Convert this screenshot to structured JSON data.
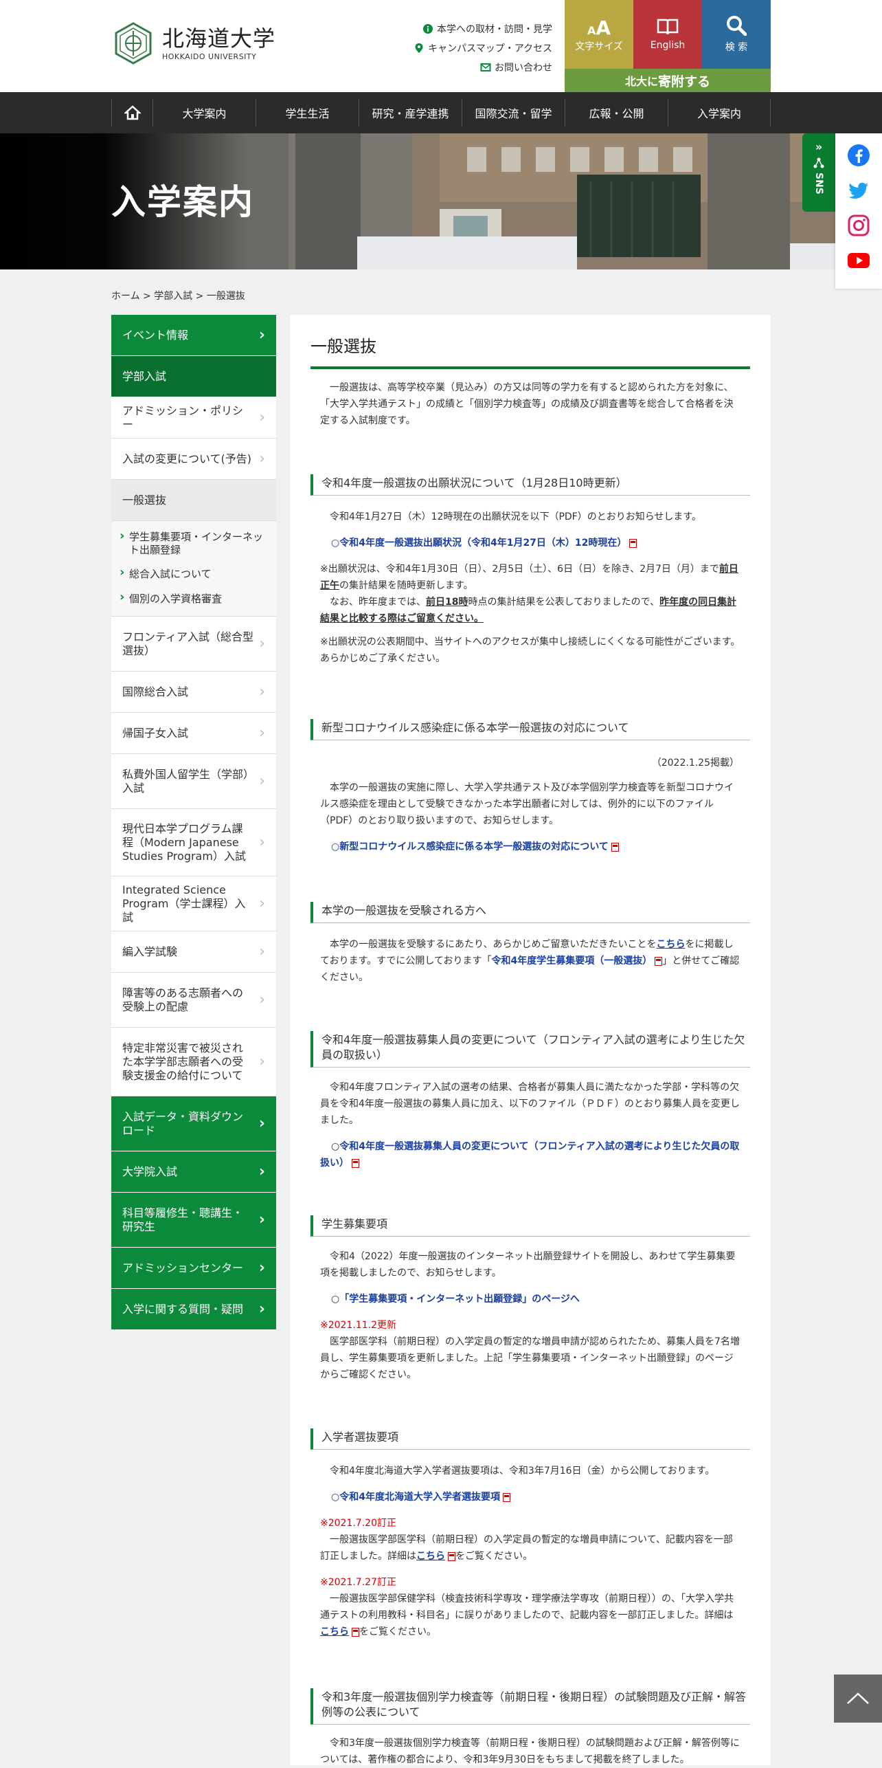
{
  "header": {
    "logo_ja": "北海道大学",
    "logo_en": "HOKKAIDO UNIVERSITY",
    "util_links": [
      "本学への取材・訪問・見学",
      "キャンパスマップ・アクセス",
      "お問い合わせ"
    ],
    "btn_font_size": "文字サイズ",
    "btn_english": "English",
    "btn_search": "検 索",
    "donate_prefix": "北大に",
    "donate_big": "寄附する",
    "colors": {
      "font": "#b9a842",
      "english": "#b8333a",
      "search": "#2b6a9c",
      "donate": "#6c9c3f"
    }
  },
  "gnav": [
    "大学案内",
    "学生生活",
    "研究・産学連携",
    "国際交流・留学",
    "広報・公開",
    "入学案内"
  ],
  "hero": {
    "title": "入学案内",
    "sns_label": "SNS"
  },
  "breadcrumb": "ホーム > 学部入試 > 一般選抜",
  "sidebar": {
    "items": [
      {
        "label": "イベント情報",
        "style": "green"
      },
      {
        "label": "学部入試",
        "style": "dgreen"
      },
      {
        "label": "アドミッション・ポリシー",
        "style": "white"
      },
      {
        "label": "入試の変更について(予告)",
        "style": "white"
      },
      {
        "label": "一般選抜",
        "style": "gray"
      }
    ],
    "sub": [
      "学生募集要項・インターネット出願登録",
      "総合入試について",
      "個別の入学資格審査"
    ],
    "items2": [
      {
        "label": "フロンティア入試（総合型選抜）",
        "style": "white"
      },
      {
        "label": "国際総合入試",
        "style": "white"
      },
      {
        "label": "帰国子女入試",
        "style": "white"
      },
      {
        "label": "私費外国人留学生（学部）入試",
        "style": "white"
      },
      {
        "label": "現代日本学プログラム課程（Modern Japanese Studies Program）入試",
        "style": "white"
      },
      {
        "label": "Integrated Science Program（学士課程）入試",
        "style": "white"
      },
      {
        "label": "編入学試験",
        "style": "white"
      },
      {
        "label": "障害等のある志願者への受験上の配慮",
        "style": "white"
      },
      {
        "label": "特定非常災害で被災された本学学部志願者への受験支援金の給付について",
        "style": "white"
      },
      {
        "label": "入試データ・資料ダウンロード",
        "style": "green"
      },
      {
        "label": "大学院入試",
        "style": "green"
      },
      {
        "label": "科目等履修生・聴講生・研究生",
        "style": "green"
      },
      {
        "label": "アドミッションセンター",
        "style": "green"
      },
      {
        "label": "入学に関する質問・疑問",
        "style": "green"
      }
    ]
  },
  "main": {
    "title": "一般選抜",
    "intro": "一般選抜は、高等学校卒業（見込み）の方又は同等の学力を有すると認められた方を対象に、「大学入学共通テスト」の成績と「個別学力検査等」の成績及び調査書等を総合して合格者を決定する入試制度です。",
    "s1": {
      "heading": "令和4年度一般選抜の出願状況について（1月28日10時更新）",
      "p1": "令和4年1月27日（木）12時現在の出願状況を以下（PDF）のとおりお知らせします。",
      "link": "○令和4年度一般選抜出願状況（令和4年1月27日（木）12時現在）",
      "n1a": "※出願状況は、令和4年1月30日（日）、2月5日（土）、6日（日）を除き、2月7日（月）まで",
      "n1b": "前日正午",
      "n1c": "の集計結果を随時更新します。",
      "n2a": "なお、昨年度までは、",
      "n2b": "前日18時",
      "n2c": "時点の集計結果を公表しておりましたので、",
      "n2d": "昨年度の同日集計結果と比較する際はご留意ください。",
      "n3": "※出願状況の公表期間中、当サイトへのアクセスが集中し接続しにくくなる可能性がございます。あらかじめご了承ください。"
    },
    "s2": {
      "heading": "新型コロナウイルス感染症に係る本学一般選抜の対応について",
      "date": "（2022.1.25掲載）",
      "p1": "本学の一般選抜の実施に際し、大学入学共通テスト及び本学個別学力検査等を新型コロナウイルス感染症を理由として受験できなかった本学出願者に対しては、例外的に以下のファイル（PDF）のとおり取り扱いますので、お知らせします。",
      "link": "○新型コロナウイルス感染症に係る本学一般選抜の対応について"
    },
    "s3": {
      "heading": "本学の一般選抜を受験される方へ",
      "p1a": "本学の一般選抜を受験するにあたり、あらかじめご留意いただきたいことを",
      "p1link": "こちら",
      "p1b": "をに掲載しております。すでに公開しております「",
      "p1link2": "令和4年度学生募集要項（一般選抜）",
      "p1c": "」と併せてご確認ください。"
    },
    "s4": {
      "heading": "令和4年度一般選抜募集人員の変更について（フロンティア入試の選考により生じた欠員の取扱い）",
      "p1": "令和4年度フロンティア入試の選考の結果、合格者が募集人員に満たなかった学部・学科等の欠員を令和4年度一般選抜の募集人員に加え、以下のファイル（ＰＤＦ）のとおり募集人員を変更しました。",
      "bullet": "○",
      "link": "令和4年度一般選抜募集人員の変更について（フロンティア入試の選考により生じた欠員の取扱い）"
    },
    "s5": {
      "heading": "学生募集要項",
      "p1": "令和4（2022）年度一般選抜のインターネット出願登録サイトを開設し、あわせて学生募集要項を掲載しましたので、お知らせします。",
      "bullet": "○",
      "link": "「学生募集要項・インターネット出願登録」のページへ",
      "red": "※2021.11.2更新",
      "p2": "医学部医学科（前期日程）の入学定員の暫定的な増員申請が認められたため、募集人員を7名増員し、学生募集要項を更新しました。上記「学生募集要項・インターネット出願登録」のページからご確認ください。"
    },
    "s6": {
      "heading": "入学者選抜要項",
      "p1": "令和4年度北海道大学入学者選抜要項は、令和3年7月16日（金）から公開しております。",
      "link": "○令和4年度北海道大学入学者選抜要項",
      "red1": "※2021.7.20訂正",
      "p2a": "一般選抜医学部医学科（前期日程）の入学定員の暫定的な増員申請について、記載内容を一部訂正しました。詳細は",
      "p2link": "こちら",
      "p2b": "をご覧ください。",
      "red2": "※2021.7.27訂正",
      "p3a": "一般選抜医学部保健学科（検査技術科学専攻・理学療法学専攻（前期日程））の、「大学入学共通テストの利用教科・科目名」に誤りがありましたので、記載内容を一部訂正しました。詳細は",
      "p3link": "こちら",
      "p3b": "をご覧ください。"
    },
    "s7": {
      "heading": "令和3年度一般選抜個別学力検査等（前期日程・後期日程）の試験問題及び正解・解答例等の公表について",
      "p1": "令和3年度一般選抜個別学力検査等（前期日程・後期日程）の試験問題および正解・解答例等については、著作権の都合により、令和3年9月30日をもちまして掲載を終了しました。"
    }
  }
}
